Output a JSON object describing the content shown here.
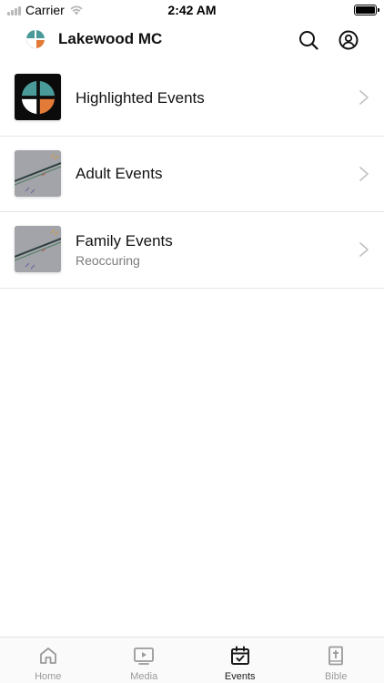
{
  "status_bar": {
    "carrier": "Carrier",
    "time": "2:42 AM",
    "battery_level_percent": 100
  },
  "header": {
    "title": "Lakewood MC",
    "icons": [
      "logo-icon",
      "search-icon",
      "profile-icon"
    ]
  },
  "events": [
    {
      "title": "Highlighted Events",
      "subtitle": "",
      "thumbnail": "church-logo"
    },
    {
      "title": "Adult Events",
      "subtitle": "",
      "thumbnail": "photo"
    },
    {
      "title": "Family Events",
      "subtitle": "Reoccuring",
      "thumbnail": "photo"
    }
  ],
  "tabs": [
    {
      "label": "Home",
      "icon": "home-icon",
      "active": false
    },
    {
      "label": "Media",
      "icon": "media-icon",
      "active": false
    },
    {
      "label": "Events",
      "icon": "calendar-check-icon",
      "active": true
    },
    {
      "label": "Bible",
      "icon": "bible-icon",
      "active": false
    }
  ],
  "colors": {
    "logo_teal": "#4a9a9a",
    "logo_orange": "#e27b37",
    "logo_white": "#ffffff",
    "active_tab": "#1a1a1a",
    "inactive_tab": "#9a9a9a"
  }
}
